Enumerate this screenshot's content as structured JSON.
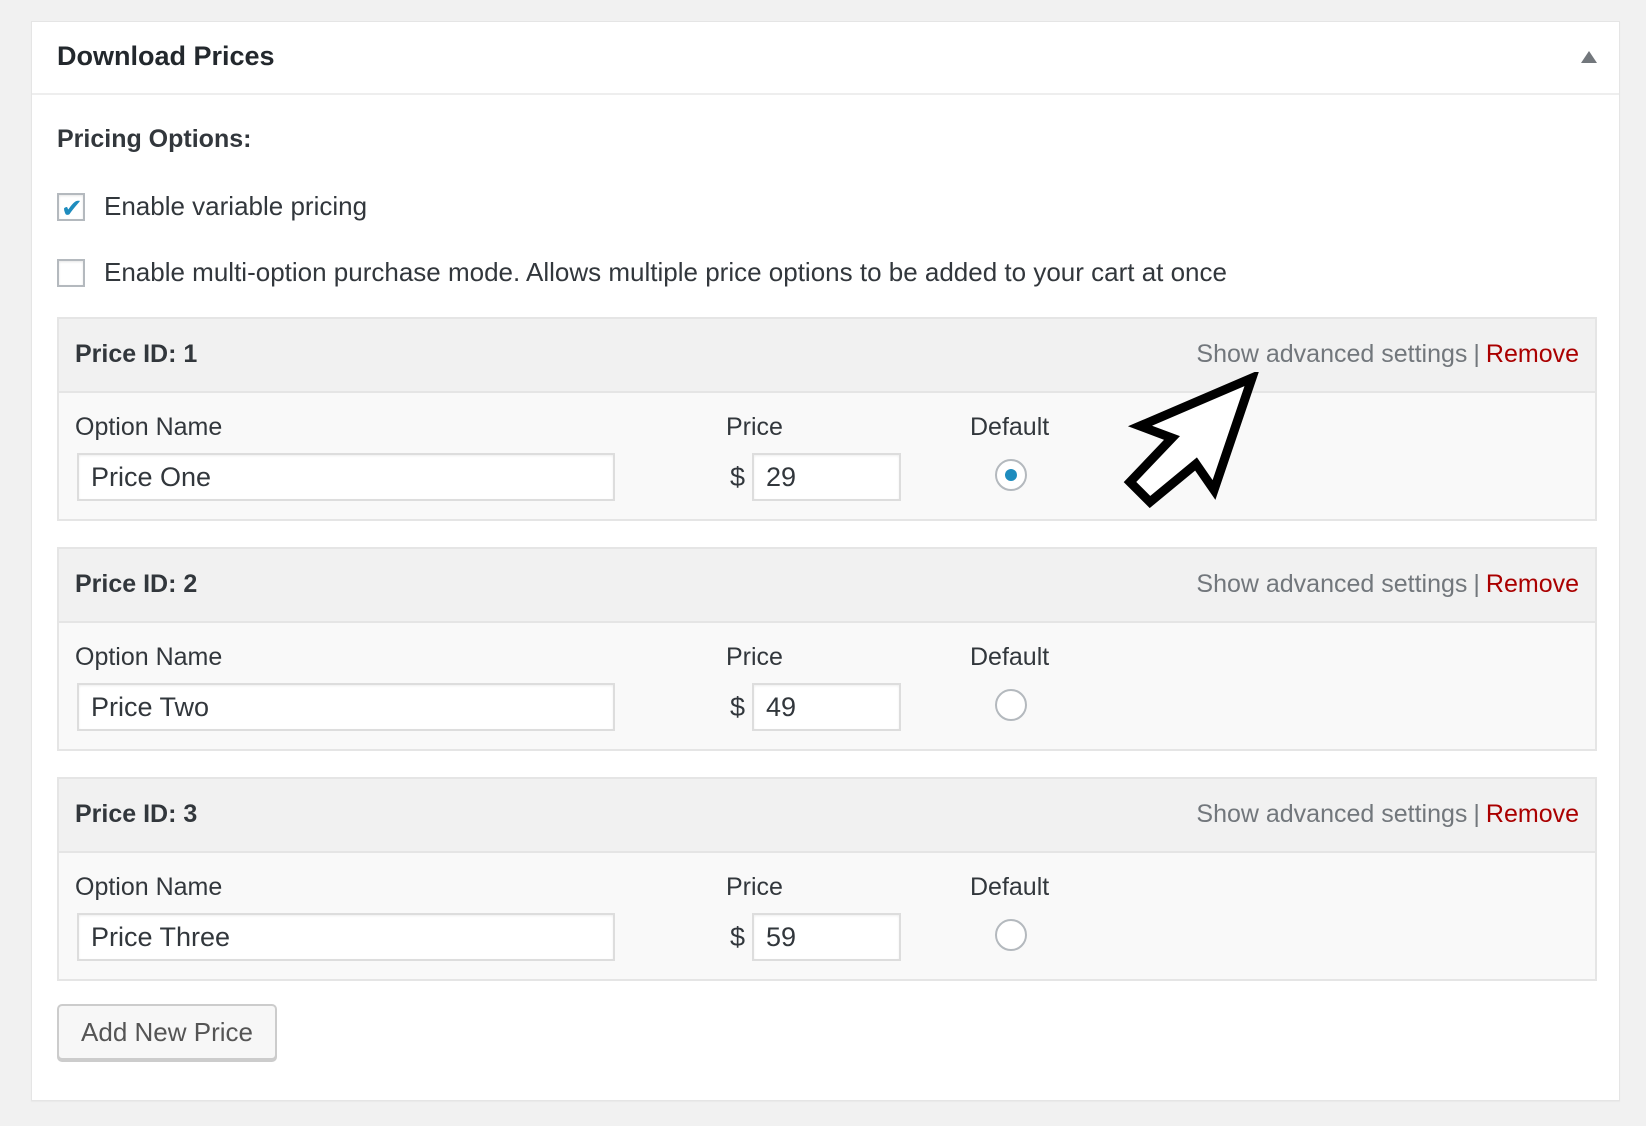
{
  "panel": {
    "title": "Download Prices",
    "collapse_icon": "triangle-up-icon"
  },
  "pricing": {
    "section_label": "Pricing Options:",
    "options": [
      {
        "label": "Enable variable pricing",
        "checked": true
      },
      {
        "label": "Enable multi-option purchase mode. Allows multiple price options to be added to your cart at once",
        "checked": false
      }
    ]
  },
  "prices": [
    {
      "id_label": "Price ID: 1",
      "option_name_label": "Option Name",
      "option_name": "Price One",
      "price_label": "Price",
      "currency": "$",
      "price": "29",
      "default_label": "Default",
      "is_default": true,
      "advanced_label": "Show advanced settings",
      "separator": "|",
      "remove_label": "Remove"
    },
    {
      "id_label": "Price ID: 2",
      "option_name_label": "Option Name",
      "option_name": "Price Two",
      "price_label": "Price",
      "currency": "$",
      "price": "49",
      "default_label": "Default",
      "is_default": false,
      "advanced_label": "Show advanced settings",
      "separator": "|",
      "remove_label": "Remove"
    },
    {
      "id_label": "Price ID: 3",
      "option_name_label": "Option Name",
      "option_name": "Price Three",
      "price_label": "Price",
      "currency": "$",
      "price": "59",
      "default_label": "Default",
      "is_default": false,
      "advanced_label": "Show advanced settings",
      "separator": "|",
      "remove_label": "Remove"
    }
  ],
  "actions": {
    "add_new_price_label": "Add New Price"
  },
  "annotation": {
    "icon": "pointer-arrow-icon"
  },
  "colors": {
    "accent": "#1e8cbe",
    "remove": "#aa0000",
    "muted": "#72777c"
  }
}
